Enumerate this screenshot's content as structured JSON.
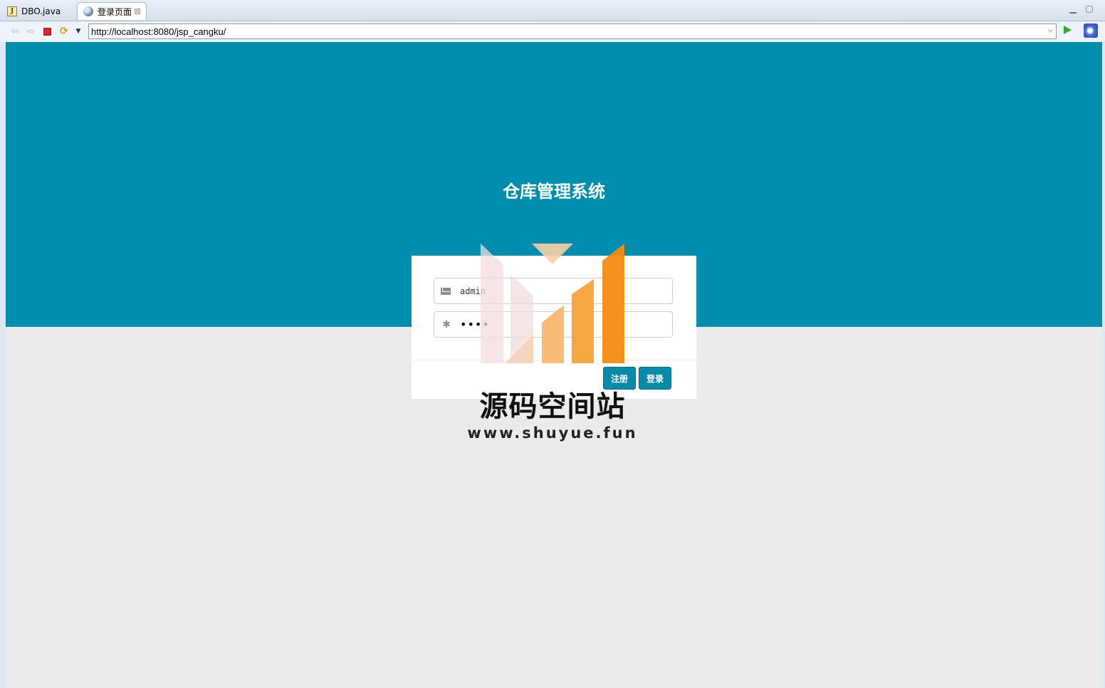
{
  "ide": {
    "tabs": [
      {
        "label": "DBO.java",
        "icon": "java-file-icon"
      },
      {
        "label": "登录页面",
        "icon": "globe-icon",
        "active": true
      }
    ],
    "window_controls": {
      "minimize": "▭",
      "maximize": "□"
    }
  },
  "browser": {
    "url": "http://localhost:8080/jsp_cangku/",
    "icons": {
      "back": "⇦",
      "forward": "⇨",
      "refresh": "⟳",
      "menu": "▼",
      "url_dropdown": "⌵"
    }
  },
  "page": {
    "title": "仓库管理系统",
    "username_value": "admin",
    "password_value": "••••",
    "register_label": "注册",
    "login_label": "登录",
    "asterisk": "✱"
  },
  "watermark": {
    "title": "源码空间站",
    "url": "www.shuyue.fun"
  },
  "colors": {
    "hero": "#008cad",
    "button": "#0b8aa8",
    "background": "#ebebeb",
    "watermark_orange": "#f68a12"
  }
}
